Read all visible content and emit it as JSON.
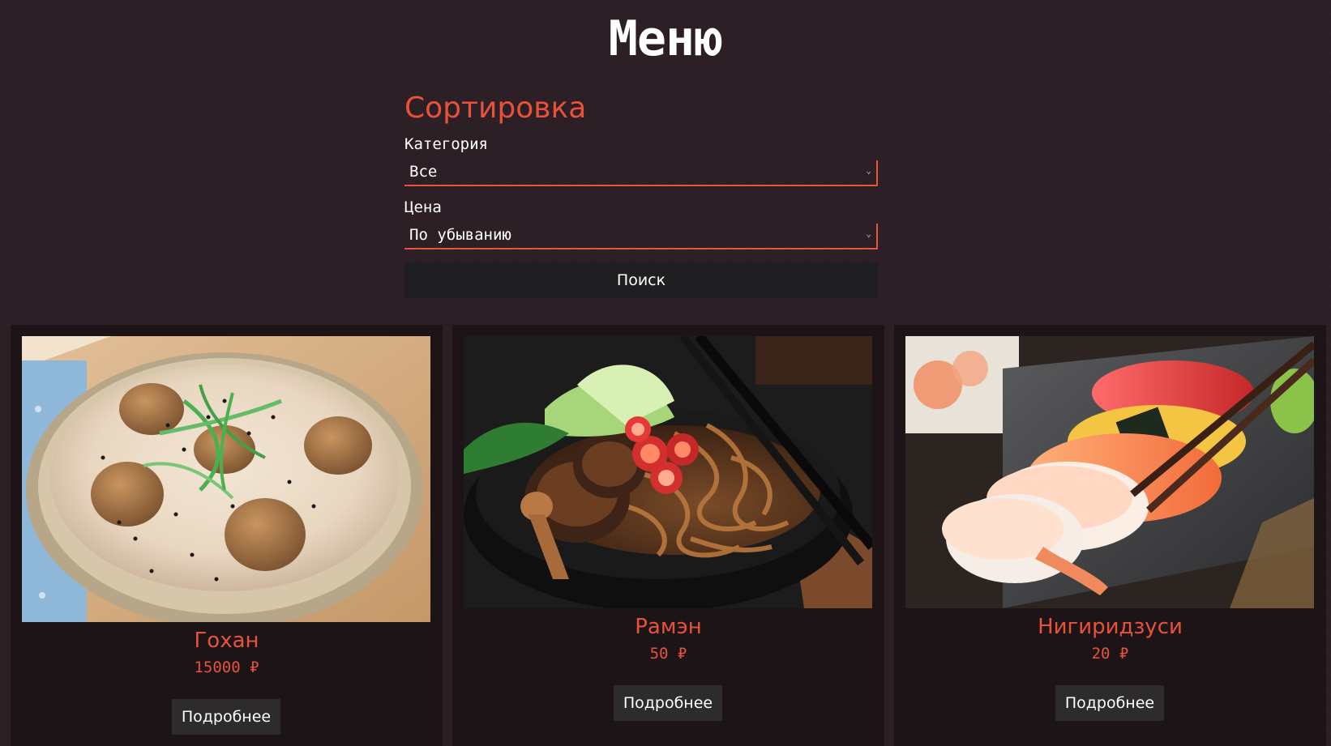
{
  "title": "Меню",
  "sort": {
    "heading": "Сортировка",
    "category_label": "Категория",
    "category_value": "Все",
    "price_label": "Цена",
    "price_value": "По убыванию",
    "search_label": "Поиск"
  },
  "dishes": [
    {
      "name": "Гохан",
      "price": "15000 ₽",
      "button": "Подробнее",
      "image": "rice-bowl-with-chestnuts"
    },
    {
      "name": "Рамэн",
      "price": "50 ₽",
      "button": "Подробнее",
      "image": "ramen-bowl-with-mushrooms"
    },
    {
      "name": "Нигиридзуси",
      "price": "20 ₽",
      "button": "Подробнее",
      "image": "nigiri-sushi-platter"
    }
  ],
  "colors": {
    "accent": "#e8523a",
    "background": "#2b1e25",
    "card": "#1d1418"
  }
}
